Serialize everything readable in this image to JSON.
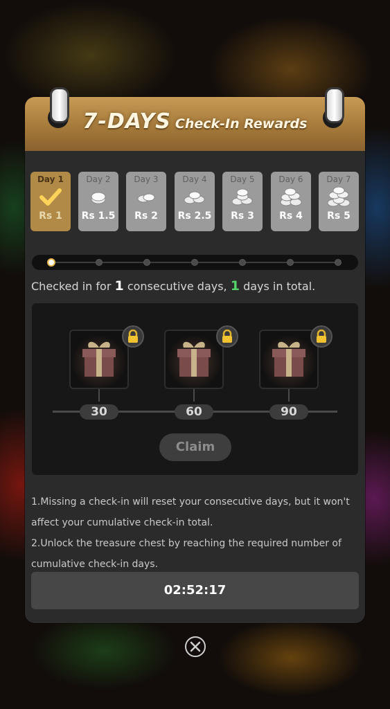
{
  "header": {
    "title_big": "7-DAYS",
    "title_small": "Check-In Rewards"
  },
  "days": [
    {
      "label": "Day 1",
      "reward": "Rs 1",
      "checked": true
    },
    {
      "label": "Day 2",
      "reward": "Rs 1.5",
      "checked": false
    },
    {
      "label": "Day 3",
      "reward": "Rs 2",
      "checked": false
    },
    {
      "label": "Day 4",
      "reward": "Rs 2.5",
      "checked": false
    },
    {
      "label": "Day 5",
      "reward": "Rs 3",
      "checked": false
    },
    {
      "label": "Day 6",
      "reward": "Rs 4",
      "checked": false
    },
    {
      "label": "Day 7",
      "reward": "Rs 5",
      "checked": false
    }
  ],
  "progress": {
    "current_step": 1,
    "total_steps": 7
  },
  "status": {
    "prefix": "Checked in for",
    "consecutive": "1",
    "middle": "consecutive days,",
    "total": "1",
    "suffix": "days in total."
  },
  "chests": [
    {
      "days": "30",
      "locked": true
    },
    {
      "days": "60",
      "locked": true
    },
    {
      "days": "90",
      "locked": true
    }
  ],
  "claim_label": "Claim",
  "rules": {
    "rule1": "1.Missing a check-in will reset your consecutive days, but it won't affect your cumulative check-in total.",
    "rule2": "2.Unlock the treasure chest by reaching the required number of cumulative check-in days."
  },
  "timer": "02:52:17",
  "colors": {
    "accent_gold": "#b08a46",
    "total_green": "#55d46a",
    "panel_bg": "#2b2b2b"
  },
  "icons": {
    "check": "checkmark-icon",
    "coin": "coins-icon",
    "lock": "lock-icon",
    "chest": "gift-box-icon",
    "close": "close-icon"
  }
}
